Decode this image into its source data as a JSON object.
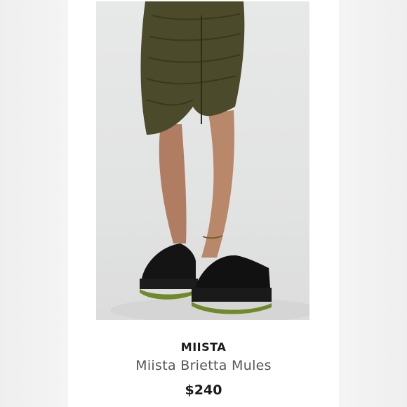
{
  "listing": {
    "brand": "MIISTA",
    "title": "Miista Brietta Mules",
    "price": "$240",
    "photo_icon": "product-photo",
    "colors": {
      "skirt": "#4b4a2a",
      "shoe": "#141414",
      "sole_accent": "#6f8a2a",
      "background": "#e4e5e5"
    }
  }
}
